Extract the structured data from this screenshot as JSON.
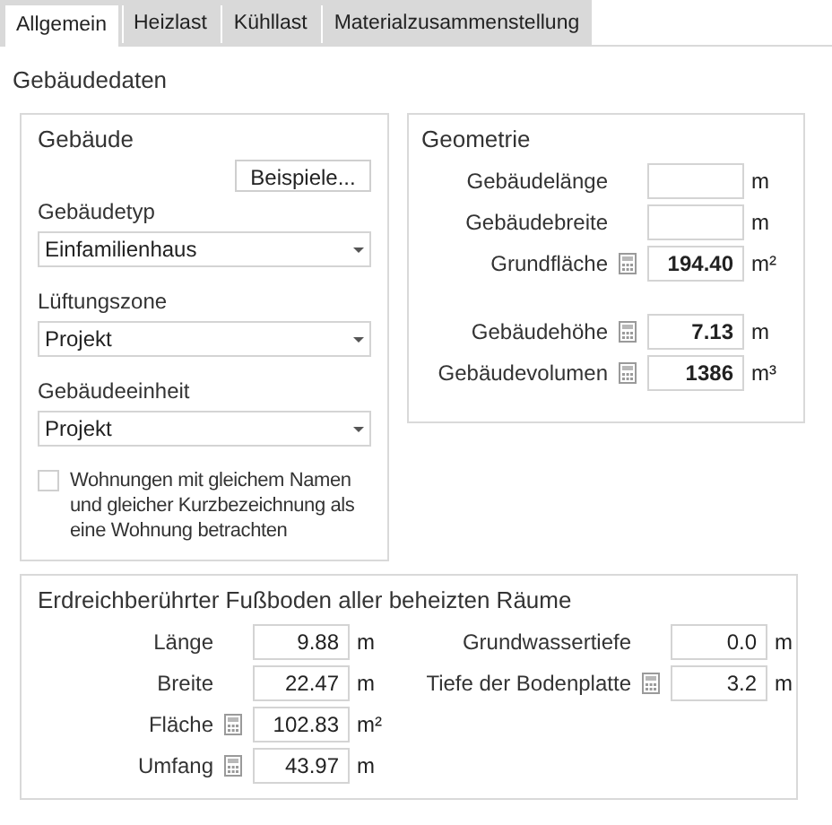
{
  "tabs": [
    {
      "label": "Allgemein",
      "selected": true
    },
    {
      "label": "Heizlast",
      "selected": false
    },
    {
      "label": "Kühllast",
      "selected": false
    },
    {
      "label": "Materialzusammenstellung",
      "selected": false
    }
  ],
  "heading": "Gebäudedaten",
  "building": {
    "title": "Gebäude",
    "examples_button": "Beispiele...",
    "selects": [
      {
        "label": "Gebäudetyp",
        "value": "Einfamilienhaus"
      },
      {
        "label": "Lüftungszone",
        "value": "Projekt"
      },
      {
        "label": "Gebäudeeinheit",
        "value": "Projekt"
      }
    ],
    "checkbox": {
      "label": "Wohnungen mit gleichem Namen und gleicher Kurzbezeichnung als eine Wohnung betrachten",
      "checked": false
    }
  },
  "geometry": {
    "title": "Geometrie",
    "rows": [
      {
        "label": "Gebäudelänge",
        "value": "",
        "unit": "m",
        "calculated": false,
        "gap_before": false
      },
      {
        "label": "Gebäudebreite",
        "value": "",
        "unit": "m",
        "calculated": false,
        "gap_before": false
      },
      {
        "label": "Grundfläche",
        "value": "194.40",
        "unit": "m²",
        "calculated": true,
        "gap_before": false
      },
      {
        "label": "Gebäudehöhe",
        "value": "7.13",
        "unit": "m",
        "calculated": true,
        "gap_before": true
      },
      {
        "label": "Gebäudevolumen",
        "value": "1386",
        "unit": "m³",
        "calculated": true,
        "gap_before": false
      }
    ]
  },
  "ground": {
    "title": "Erdreichberührter Fußboden aller beheizten Räume",
    "left_rows": [
      {
        "label": "Länge",
        "value": "9.88",
        "unit": "m",
        "calculated": false
      },
      {
        "label": "Breite",
        "value": "22.47",
        "unit": "m",
        "calculated": false
      },
      {
        "label": "Fläche",
        "value": "102.83",
        "unit": "m²",
        "calculated": true
      },
      {
        "label": "Umfang",
        "value": "43.97",
        "unit": "m",
        "calculated": true
      }
    ],
    "right_rows": [
      {
        "label": "Grundwassertiefe",
        "value": "0.0",
        "unit": "m",
        "calculated": false
      },
      {
        "label": "Tiefe der Bodenplatte",
        "value": "3.2",
        "unit": "m",
        "calculated": true
      }
    ]
  }
}
